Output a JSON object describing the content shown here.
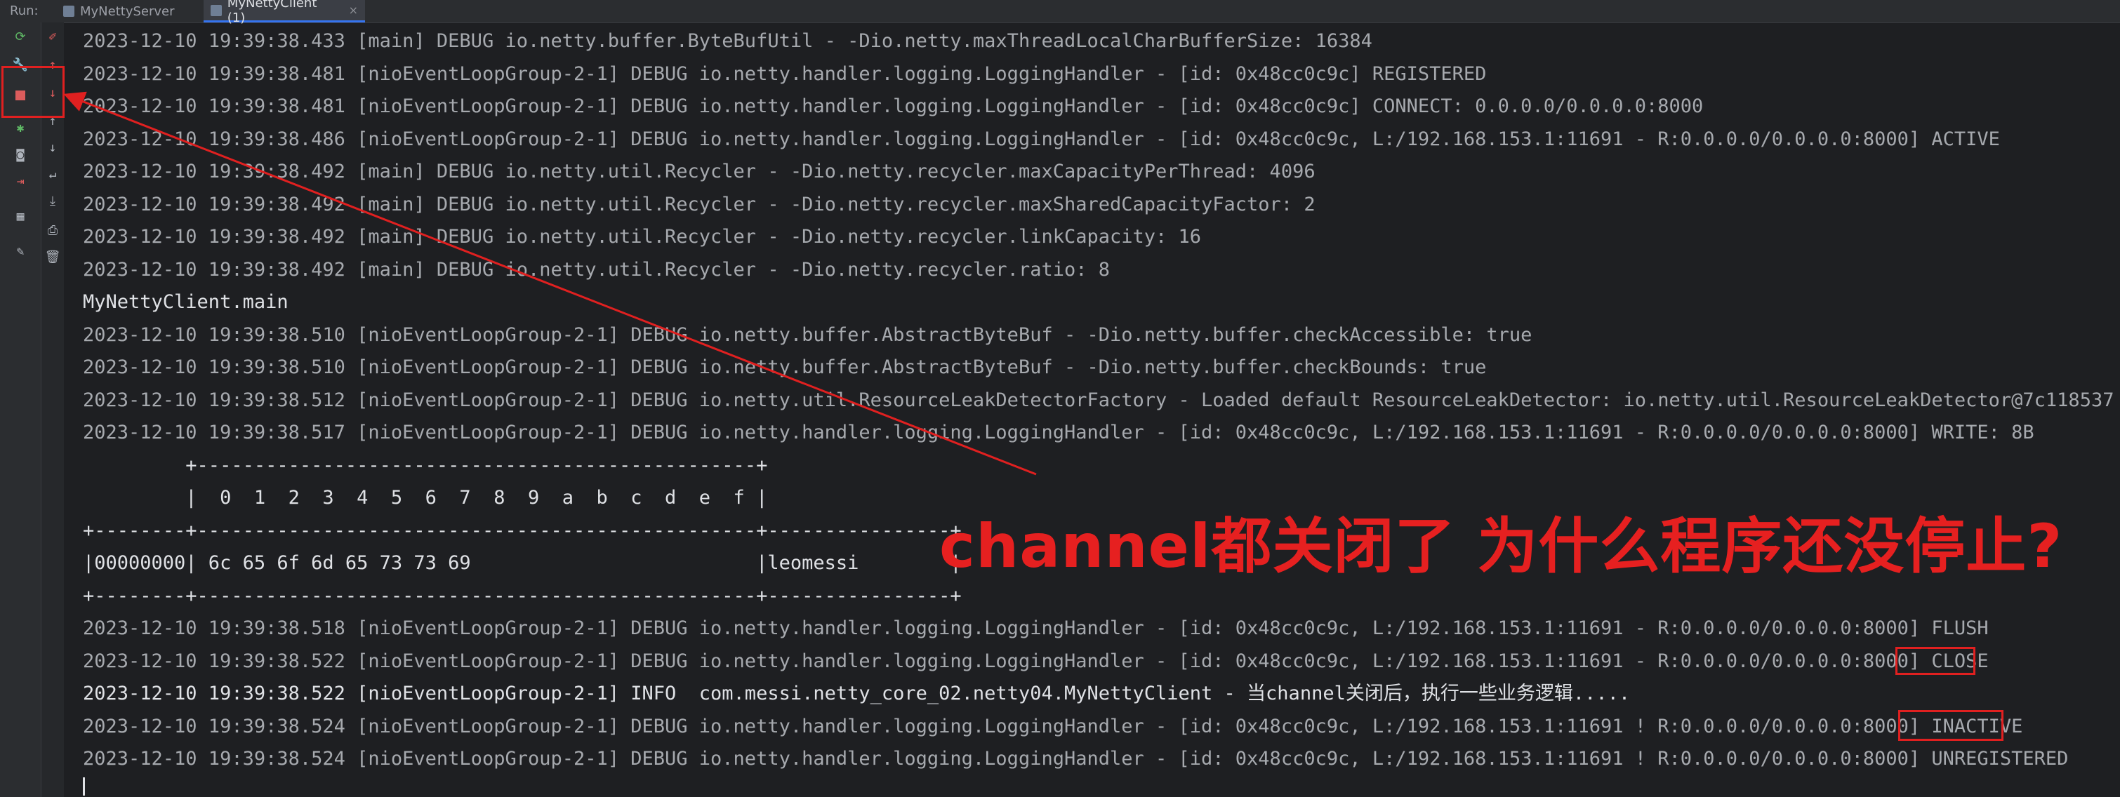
{
  "run_bar": {
    "label": "Run:",
    "tabs": [
      {
        "label": "MyNettyServer"
      },
      {
        "label": "MyNettyClient (1)"
      }
    ]
  },
  "toolbar_icons": [
    "rerun-icon",
    "wrench-icon",
    "stop-icon",
    "bug-icon",
    "camera-icon",
    "exit-icon",
    "layout-icon",
    "pin-icon",
    "eraser-icon",
    "up-arrow-icon",
    "down-arrow-icon",
    "up-small-icon",
    "down-small-icon",
    "soft-wrap-icon",
    "scroll-end-icon",
    "print-icon",
    "trash-icon"
  ],
  "console": {
    "lines": [
      {
        "text": "2023-12-10 19:39:38.433 [main] DEBUG io.netty.buffer.ByteBufUtil - -Dio.netty.maxThreadLocalCharBufferSize: 16384",
        "style": "log"
      },
      {
        "text": "2023-12-10 19:39:38.481 [nioEventLoopGroup-2-1] DEBUG io.netty.handler.logging.LoggingHandler - [id: 0x48cc0c9c] REGISTERED",
        "style": "log"
      },
      {
        "text": "2023-12-10 19:39:38.481 [nioEventLoopGroup-2-1] DEBUG io.netty.handler.logging.LoggingHandler - [id: 0x48cc0c9c] CONNECT: 0.0.0.0/0.0.0.0:8000",
        "style": "log"
      },
      {
        "text": "2023-12-10 19:39:38.486 [nioEventLoopGroup-2-1] DEBUG io.netty.handler.logging.LoggingHandler - [id: 0x48cc0c9c, L:/192.168.153.1:11691 - R:0.0.0.0/0.0.0.0:8000] ACTIVE",
        "style": "log"
      },
      {
        "text": "2023-12-10 19:39:38.492 [main] DEBUG io.netty.util.Recycler - -Dio.netty.recycler.maxCapacityPerThread: 4096",
        "style": "log"
      },
      {
        "text": "2023-12-10 19:39:38.492 [main] DEBUG io.netty.util.Recycler - -Dio.netty.recycler.maxSharedCapacityFactor: 2",
        "style": "log"
      },
      {
        "text": "2023-12-10 19:39:38.492 [main] DEBUG io.netty.util.Recycler - -Dio.netty.recycler.linkCapacity: 16",
        "style": "log"
      },
      {
        "text": "2023-12-10 19:39:38.492 [main] DEBUG io.netty.util.Recycler - -Dio.netty.recycler.ratio: 8",
        "style": "log"
      },
      {
        "text": "MyNettyClient.main",
        "style": "white"
      },
      {
        "text": "2023-12-10 19:39:38.510 [nioEventLoopGroup-2-1] DEBUG io.netty.buffer.AbstractByteBuf - -Dio.netty.buffer.checkAccessible: true",
        "style": "log"
      },
      {
        "text": "2023-12-10 19:39:38.510 [nioEventLoopGroup-2-1] DEBUG io.netty.buffer.AbstractByteBuf - -Dio.netty.buffer.checkBounds: true",
        "style": "log"
      },
      {
        "text": "2023-12-10 19:39:38.512 [nioEventLoopGroup-2-1] DEBUG io.netty.util.ResourceLeakDetectorFactory - Loaded default ResourceLeakDetector: io.netty.util.ResourceLeakDetector@7c118537",
        "style": "log"
      },
      {
        "text": "2023-12-10 19:39:38.517 [nioEventLoopGroup-2-1] DEBUG io.netty.handler.logging.LoggingHandler - [id: 0x48cc0c9c, L:/192.168.153.1:11691 - R:0.0.0.0/0.0.0.0:8000] WRITE: 8B",
        "style": "log"
      },
      {
        "text": "         +-------------------------------------------------+",
        "style": "white"
      },
      {
        "text": "         |  0  1  2  3  4  5  6  7  8  9  a  b  c  d  e  f |",
        "style": "white"
      },
      {
        "text": "+--------+-------------------------------------------------+----------------+",
        "style": "white"
      },
      {
        "text": "|00000000| 6c 65 6f 6d 65 73 73 69                         |leomessi        |",
        "style": "white"
      },
      {
        "text": "+--------+-------------------------------------------------+----------------+",
        "style": "white"
      },
      {
        "text": "2023-12-10 19:39:38.518 [nioEventLoopGroup-2-1] DEBUG io.netty.handler.logging.LoggingHandler - [id: 0x48cc0c9c, L:/192.168.153.1:11691 - R:0.0.0.0/0.0.0.0:8000] FLUSH",
        "style": "log"
      },
      {
        "text": "2023-12-10 19:39:38.522 [nioEventLoopGroup-2-1] DEBUG io.netty.handler.logging.LoggingHandler - [id: 0x48cc0c9c, L:/192.168.153.1:11691 - R:0.0.0.0/0.0.0.0:8000] CLOSE",
        "style": "log"
      },
      {
        "text": "2023-12-10 19:39:38.522 [nioEventLoopGroup-2-1] INFO  com.messi.netty_core_02.netty04.MyNettyClient - 当channel关闭后，执行一些业务逻辑.....",
        "style": "white"
      },
      {
        "text": "2023-12-10 19:39:38.524 [nioEventLoopGroup-2-1] DEBUG io.netty.handler.logging.LoggingHandler - [id: 0x48cc0c9c, L:/192.168.153.1:11691 ! R:0.0.0.0/0.0.0.0:8000] INACTIVE",
        "style": "log"
      },
      {
        "text": "2023-12-10 19:39:38.524 [nioEventLoopGroup-2-1] DEBUG io.netty.handler.logging.LoggingHandler - [id: 0x48cc0c9c, L:/192.168.153.1:11691 ! R:0.0.0.0/0.0.0.0:8000] UNREGISTERED",
        "style": "log"
      }
    ]
  },
  "annotation": {
    "text": "channel都关闭了 为什么程序还没停止?",
    "color": "#e62020"
  },
  "colors": {
    "background": "#1e1f22",
    "log_text": "#a6a9ae",
    "bright_text": "#dfe1e5",
    "annotation": "#e02020"
  }
}
